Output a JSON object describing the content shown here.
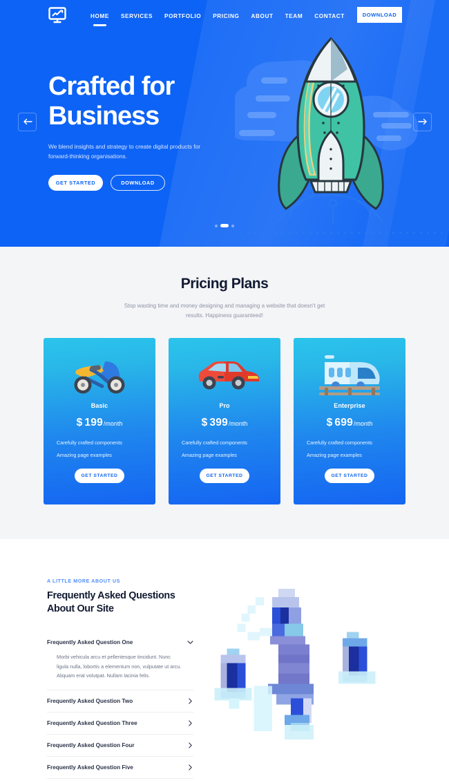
{
  "theme": {
    "brand_blue": "#0d63f5",
    "section_gray": "#f4f5f7",
    "card_gradient_top": "#2bc4ec",
    "card_gradient_bottom": "#1565f2",
    "heading_dark": "#121b32",
    "muted_text": "#8d93a3",
    "eyebrow_blue": "#4f8df9"
  },
  "nav": {
    "logo_icon": "monitor-chart-icon",
    "links": [
      {
        "label": "HOME",
        "active": true
      },
      {
        "label": "SERVICES",
        "active": false
      },
      {
        "label": "PORTFOLIO",
        "active": false
      },
      {
        "label": "PRICING",
        "active": false
      },
      {
        "label": "ABOUT",
        "active": false
      },
      {
        "label": "TEAM",
        "active": false
      },
      {
        "label": "CONTACT",
        "active": false
      }
    ],
    "download_label": "DOWNLOAD"
  },
  "hero": {
    "title_line1": "Crafted for",
    "title_line2": "Business",
    "subtitle": "We blend insights and strategy to create digital products for forward-thinking organisations.",
    "primary_button": "GET STARTED",
    "secondary_button": "DOWNLOAD",
    "prev_icon": "arrow-left-icon",
    "next_icon": "arrow-right-icon",
    "illustration": "rocket-illustration",
    "slides": 3,
    "active_slide": 2
  },
  "pricing": {
    "title": "Pricing Plans",
    "subtitle": "Stop wasting time and money designing and managing a website that doesn't get results. Happiness guaranteed!",
    "plans": [
      {
        "icon": "motorcycle-icon",
        "name": "Basic",
        "currency": "$",
        "amount": "199",
        "period": "/month",
        "features": [
          "Carefully crafted components",
          "Amazing page examples"
        ],
        "cta": "GET STARTED"
      },
      {
        "icon": "car-icon",
        "name": "Pro",
        "currency": "$",
        "amount": "399",
        "period": "/month",
        "features": [
          "Carefully crafted components",
          "Amazing page examples"
        ],
        "cta": "GET STARTED"
      },
      {
        "icon": "train-icon",
        "name": "Enterprise",
        "currency": "$",
        "amount": "699",
        "period": "/month",
        "features": [
          "Carefully crafted components",
          "Amazing page examples"
        ],
        "cta": "GET STARTED"
      }
    ]
  },
  "faq": {
    "eyebrow": "A LITTLE MORE ABOUT US",
    "heading_line1": "Frequently Asked Questions",
    "heading_line2": "About Our Site",
    "illustration": "rockets-illustration",
    "items": [
      {
        "question": "Frequently Asked Question One",
        "expanded": true,
        "icon": "chevron-down-icon",
        "answer": "Morbi vehicula arcu et pellentesque tincidunt. Nunc ligula nulla, lobortis a elementum non, vulputate ut arcu. Aliquam erat volutpat. Nullam lacinia felis."
      },
      {
        "question": "Frequently Asked Question Two",
        "expanded": false,
        "icon": "chevron-right-icon",
        "answer": ""
      },
      {
        "question": "Frequently Asked Question Three",
        "expanded": false,
        "icon": "chevron-right-icon",
        "answer": ""
      },
      {
        "question": "Frequently Asked Question Four",
        "expanded": false,
        "icon": "chevron-right-icon",
        "answer": ""
      },
      {
        "question": "Frequently Asked Question Five",
        "expanded": false,
        "icon": "chevron-right-icon",
        "answer": ""
      }
    ]
  }
}
